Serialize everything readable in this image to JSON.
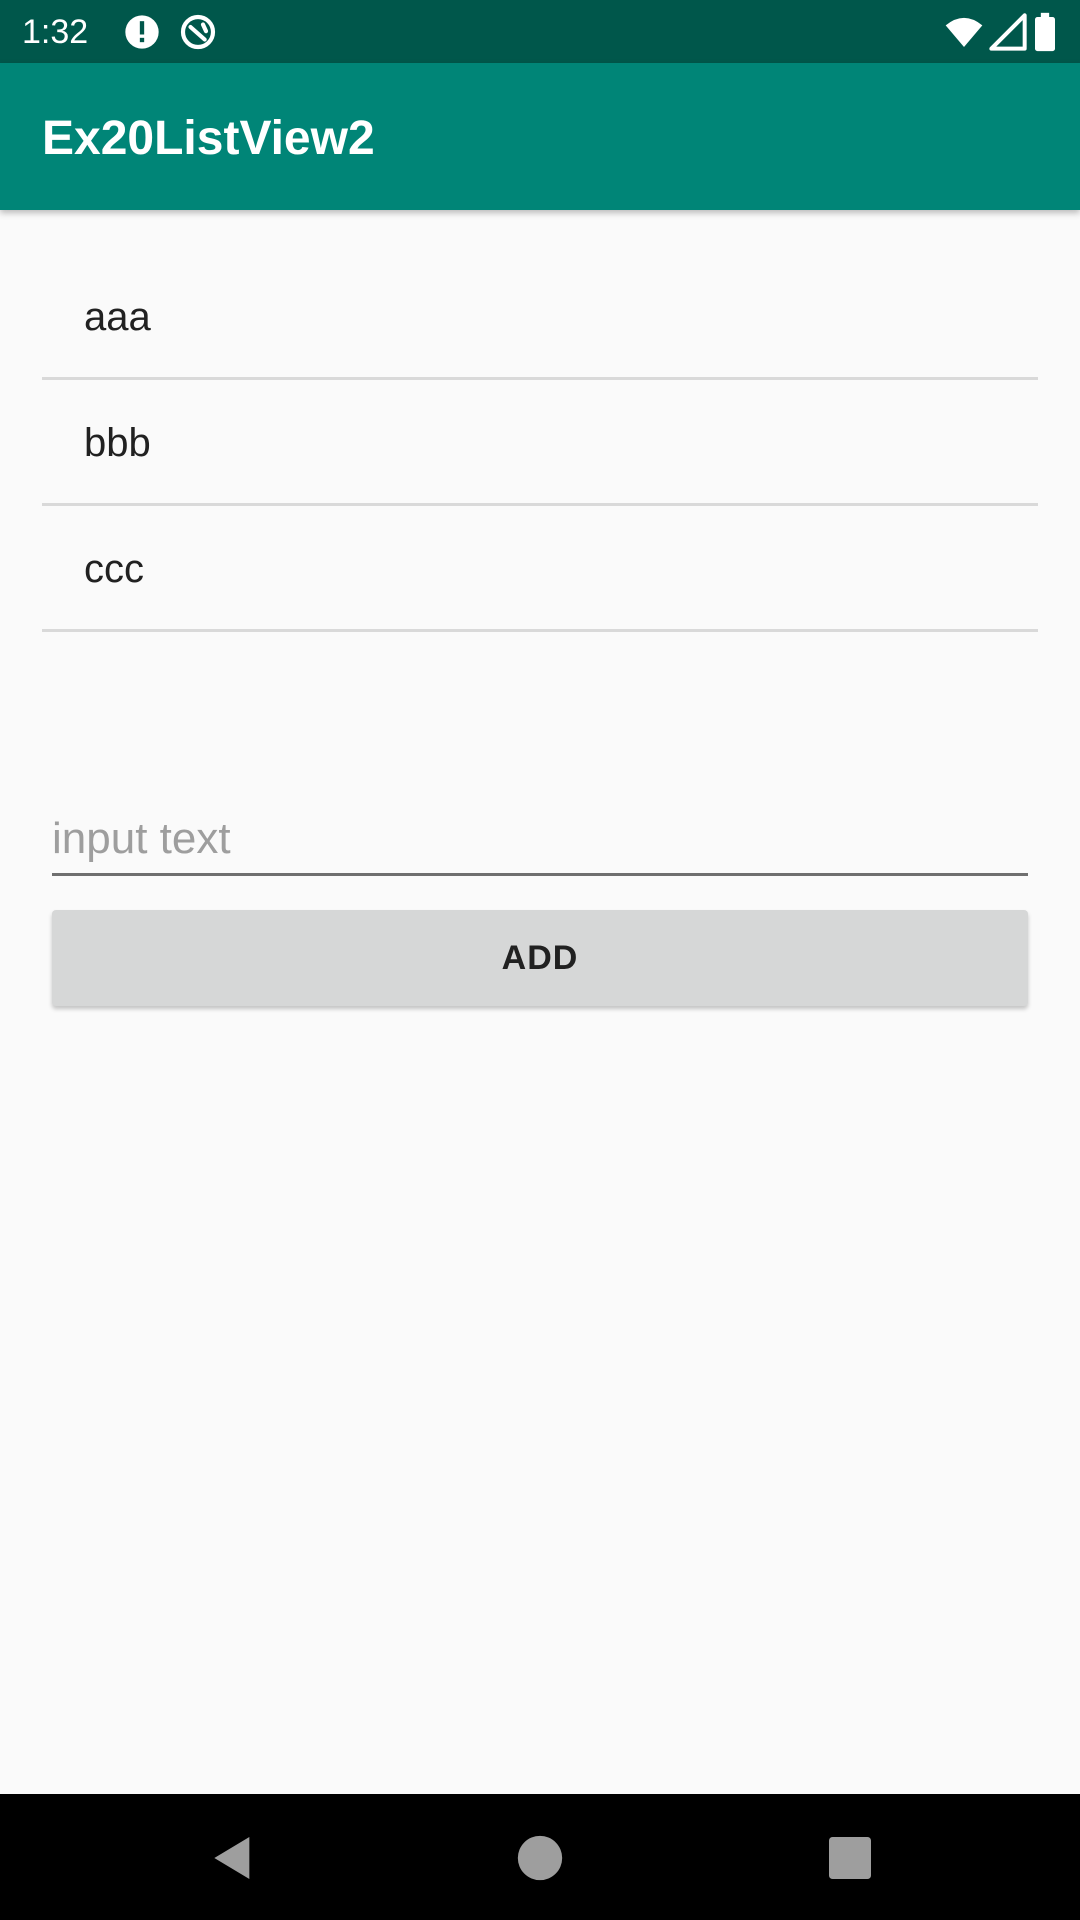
{
  "status_bar": {
    "time": "1:32",
    "icons": [
      "alert-circle-icon",
      "sync-circle-icon",
      "wifi-icon",
      "cellular-signal-icon",
      "battery-icon"
    ]
  },
  "app_bar": {
    "title": "Ex20ListView2"
  },
  "list": {
    "items": [
      "aaa",
      "bbb",
      "ccc"
    ]
  },
  "input": {
    "value": "",
    "placeholder": "input text"
  },
  "add_button": {
    "label": "ADD"
  },
  "nav_bar": {
    "buttons": [
      "back-icon",
      "home-icon",
      "recents-icon"
    ]
  },
  "colors": {
    "status_bar": "#00574b",
    "app_bar": "#008577",
    "background": "#fafafa",
    "button": "#d6d7d7"
  }
}
